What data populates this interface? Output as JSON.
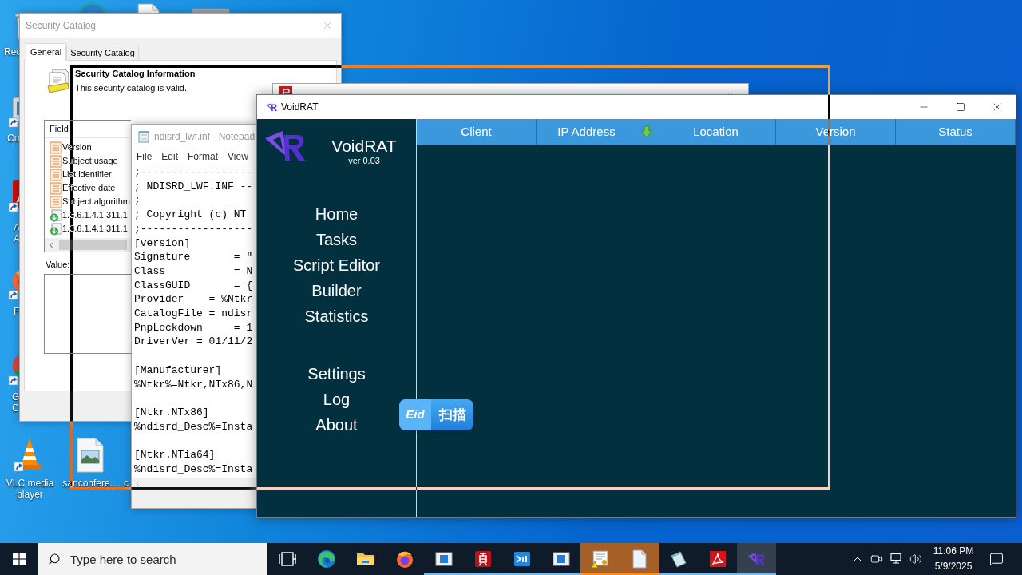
{
  "desktop": {
    "icons": [
      {
        "kind": "recycle-bin",
        "label": "Rec"
      },
      {
        "kind": "round-app"
      },
      {
        "kind": "file"
      },
      {
        "kind": "app"
      },
      {
        "kind": "app-shortcut",
        "label": "Cu"
      },
      {
        "kind": "pdf-shortcut",
        "label": "A\nA"
      },
      {
        "kind": "firefox-shortcut",
        "label": "F"
      },
      {
        "kind": "chrome-shortcut",
        "label": "G\nC"
      },
      {
        "kind": "vlc-shortcut",
        "label": "VLC media player"
      },
      {
        "kind": "image-file",
        "label": "sanconfere..."
      },
      {
        "label": "c"
      }
    ]
  },
  "security_catalog_window": {
    "title": "Security Catalog",
    "tabs": [
      {
        "label": "General",
        "selected": true
      },
      {
        "label": "Security Catalog",
        "selected": false
      }
    ],
    "heading": "Security Catalog Information",
    "message": "This security catalog is valid.",
    "field_list": {
      "header": "Field",
      "rows": [
        {
          "kind": "property",
          "label": "Version"
        },
        {
          "kind": "property",
          "label": "Subject usage"
        },
        {
          "kind": "property",
          "label": "List identifier"
        },
        {
          "kind": "property",
          "label": "Effective date"
        },
        {
          "kind": "property",
          "label": "Subject algorithm"
        },
        {
          "kind": "extension",
          "label": "1.3.6.1.4.1.311.1"
        },
        {
          "kind": "extension",
          "label": "1.3.6.1.4.1.311.1"
        }
      ]
    },
    "value_label": "Value:"
  },
  "notepad_window": {
    "title": "ndisrd_lwf.inf - Notepad",
    "menu": [
      "File",
      "Edit",
      "Format",
      "View"
    ],
    "text": ";------------------\n; NDISRD_LWF.INF --\n;\n; Copyright (c) NT\n;------------------\n[version]\nSignature       = \"\nClass           = N\nClassGUID       = {\nProvider    = %Ntkr\nCatalogFile = ndisr\nPnpLockdown     = 1\nDriverVer = 01/11/2\n\n[Manufacturer]\n%Ntkr%=Ntkr,NTx86,N\n\n[Ntkr.NTx86]\n%ndisrd_Desc%=Insta\n\n[Ntkr.NTia64]\n%ndisrd_Desc%=Insta"
  },
  "voidrat_window": {
    "title": "VoidRAT",
    "app_name": "VoidRAT",
    "version": "ver 0.03",
    "nav_groups": [
      [
        "Home",
        "Tasks",
        "Script Editor",
        "Builder",
        "Statistics"
      ],
      [
        "Settings",
        "Log",
        "About"
      ]
    ],
    "columns": [
      {
        "label": "Client",
        "sorted": false
      },
      {
        "label": "IP Address",
        "sorted": true
      },
      {
        "label": "Location",
        "sorted": false
      },
      {
        "label": "Version",
        "sorted": false
      },
      {
        "label": "Status",
        "sorted": false
      }
    ]
  },
  "scan_widget": {
    "logo": "Eid",
    "label": "扫描"
  },
  "taskbar": {
    "search": {
      "placeholder": "Type here to search"
    },
    "apps": [
      {
        "kind": "task-view",
        "running": false,
        "attention": false,
        "selected": false
      },
      {
        "kind": "edge",
        "running": false,
        "attention": false,
        "selected": false
      },
      {
        "kind": "explorer",
        "running": false,
        "attention": false,
        "selected": false
      },
      {
        "kind": "firefox",
        "running": false,
        "attention": false,
        "selected": false
      },
      {
        "kind": "window",
        "running": true,
        "attention": false,
        "selected": false
      },
      {
        "kind": "glyph-tile",
        "running": true,
        "attention": false,
        "selected": false
      },
      {
        "kind": "eid",
        "running": true,
        "attention": false,
        "selected": false
      },
      {
        "kind": "window",
        "running": true,
        "attention": false,
        "selected": false
      },
      {
        "kind": "certificate",
        "running": true,
        "attention": true,
        "selected": false
      },
      {
        "kind": "document",
        "running": true,
        "attention": true,
        "selected": false
      },
      {
        "kind": "notepad",
        "running": true,
        "attention": false,
        "selected": false
      },
      {
        "kind": "pdf",
        "running": true,
        "attention": false,
        "selected": false
      },
      {
        "kind": "voidrat",
        "running": true,
        "attention": false,
        "selected": true
      }
    ],
    "clock": {
      "time": "11:06 PM",
      "date": "5/9/2025"
    }
  }
}
